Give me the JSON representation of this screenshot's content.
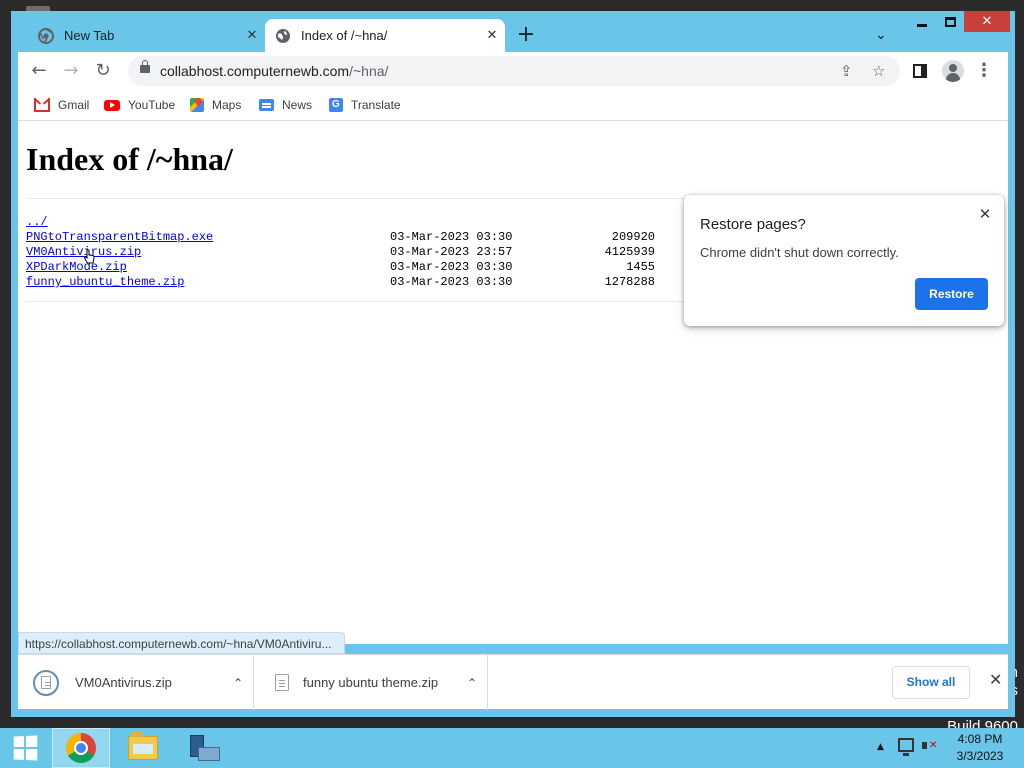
{
  "desktop": {
    "watermark_line1": "n",
    "watermark_line2": "s",
    "watermark_build": "Build 9600"
  },
  "tabs": [
    {
      "title": "New Tab",
      "favicon": "chrome-icon",
      "active": false
    },
    {
      "title": "Index of /~hna/",
      "favicon": "globe-icon",
      "active": true
    }
  ],
  "toolbar": {
    "back": "←",
    "forward": "→",
    "reload": "↻",
    "url_host": "collabhost.computernewb.com",
    "url_path": "/~hna/",
    "share_icon": "share-icon",
    "star_icon": "star-icon"
  },
  "bookmarks": [
    {
      "label": "Gmail",
      "icon": "gmail-icon"
    },
    {
      "label": "YouTube",
      "icon": "youtube-icon"
    },
    {
      "label": "Maps",
      "icon": "maps-icon"
    },
    {
      "label": "News",
      "icon": "news-icon"
    },
    {
      "label": "Translate",
      "icon": "translate-icon"
    }
  ],
  "page": {
    "title": "Index of /~hna/",
    "parent_link": "../",
    "files": [
      {
        "name": "PNGtoTransparentBitmap.exe",
        "date": "03-Mar-2023 03:30",
        "size": "209920"
      },
      {
        "name": "VM0Antivirus.zip",
        "date": "03-Mar-2023 23:57",
        "size": "4125939"
      },
      {
        "name": "XPDarkMode.zip",
        "date": "03-Mar-2023 03:30",
        "size": "1455"
      },
      {
        "name": "funny_ubuntu_theme.zip",
        "date": "03-Mar-2023 03:30",
        "size": "1278288"
      }
    ]
  },
  "restore_popup": {
    "title": "Restore pages?",
    "message": "Chrome didn't shut down correctly.",
    "button": "Restore",
    "accent": "#1a73e8"
  },
  "status_bar": {
    "url": "https://collabhost.computernewb.com/~hna/VM0Antiviru..."
  },
  "downloads": {
    "items": [
      {
        "name": "VM0Antivirus.zip"
      },
      {
        "name": "funny ubuntu theme.zip"
      }
    ],
    "show_all": "Show all"
  },
  "taskbar": {
    "time": "4:08 PM",
    "date": "3/3/2023",
    "accent": "#69c6e9"
  }
}
